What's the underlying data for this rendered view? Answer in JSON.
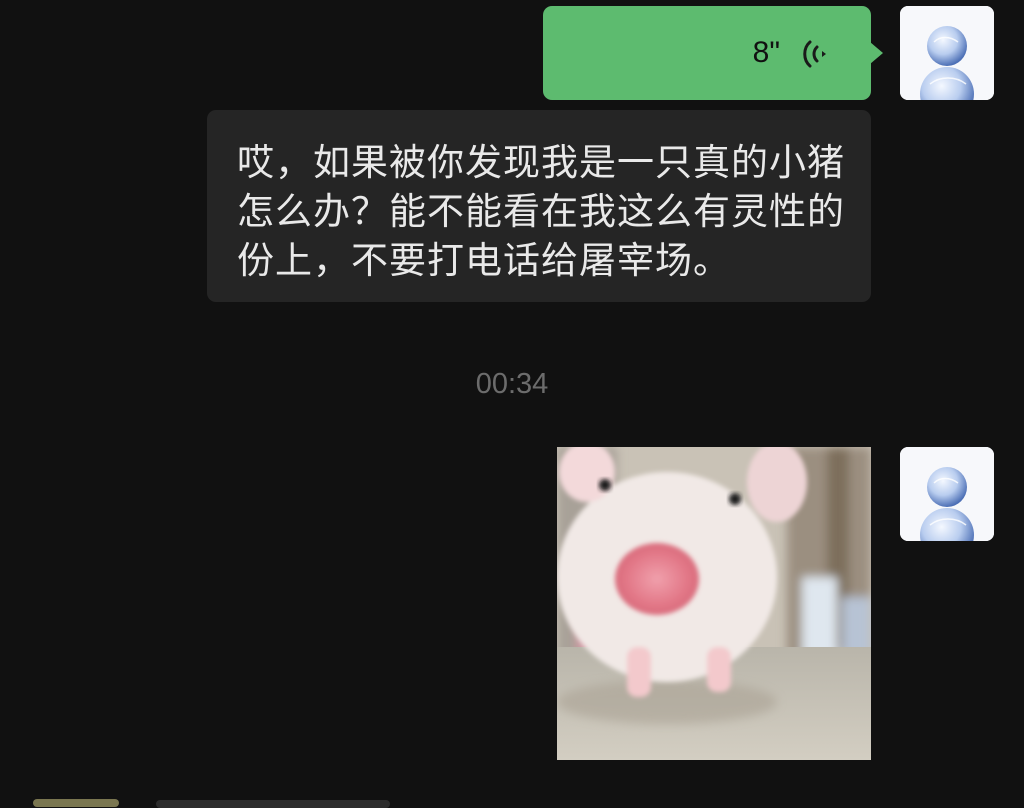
{
  "colors": {
    "background": "#111111",
    "outgoing_bubble": "#5dbb6f",
    "incoming_bubble": "#252525",
    "timestamp_text": "#6c6c6c"
  },
  "messages": {
    "voice": {
      "duration": "8\"",
      "icon": "voice-wave-icon"
    },
    "incoming_text": {
      "lines": [
        "哎，如果被你发现我是一只真的小猪",
        "怎么办？能不能看在我这么有灵性的",
        "份上，不要打电话给屠宰场。"
      ]
    },
    "timestamp": "00:34",
    "image": {
      "content": "pig-photo"
    }
  },
  "avatars": {
    "icon": "bubbles-avatar-icon"
  }
}
